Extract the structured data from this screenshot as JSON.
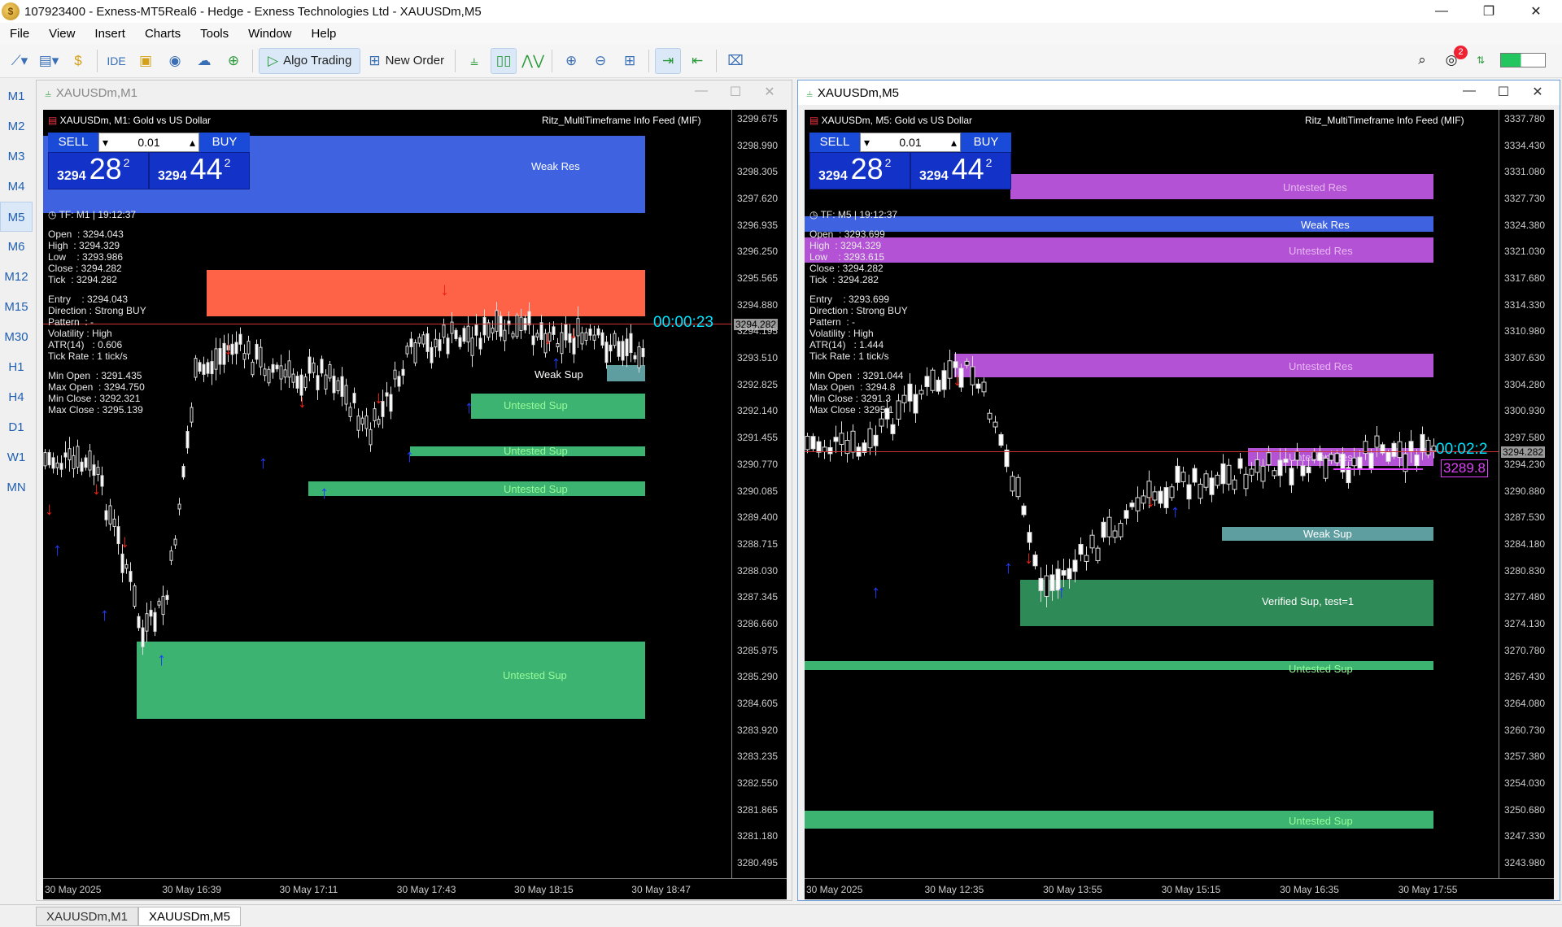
{
  "window": {
    "title": "107923400 - Exness-MT5Real6 - Hedge - Exness Technologies Ltd - XAUUSDm,M5",
    "minimize": "—",
    "maximize": "❐",
    "close": "✕"
  },
  "menu": [
    "File",
    "Insert",
    "Charts",
    "Tools",
    "Window",
    "Help",
    "View"
  ],
  "menu_order": [
    "File",
    "View",
    "Insert",
    "Charts",
    "Tools",
    "Window",
    "Help"
  ],
  "toolbar": {
    "ide": "IDE",
    "algo": "Algo Trading",
    "new_order": "New Order",
    "badge": "2"
  },
  "timeframes": [
    "M1",
    "M2",
    "M3",
    "M4",
    "M5",
    "M6",
    "M12",
    "M15",
    "M30",
    "H1",
    "H4",
    "D1",
    "W1",
    "MN"
  ],
  "active_timeframe": "M5",
  "charts": [
    {
      "title": "XAUUSDm,M1",
      "header": "XAUUSDm, M1:  Gold vs US Dollar",
      "indicator": "Ritz_MultiTimeframe Info Feed (MIF)",
      "trade": {
        "sell": "SELL",
        "buy": "BUY",
        "lot": "0.01",
        "bid_small": "3294",
        "bid_big": "28",
        "bid_sup": "2",
        "ask_small": "3294",
        "ask_big": "44",
        "ask_sup": "2"
      },
      "tf_line": "TF: M1 | 19:12:37",
      "ohlc": [
        "Open  : 3294.043",
        "High  : 3294.329",
        "Low    : 3293.986",
        "Close : 3294.282",
        "Tick  : 3294.282"
      ],
      "signal": [
        "Entry    : 3294.043",
        "Direction : Strong BUY",
        "Pattern  : -",
        "Volatility : High",
        "ATR(14)   : 0.606",
        "Tick Rate : 1 tick/s"
      ],
      "stats": [
        "Min Open  : 3291.435",
        "Max Open  : 3294.750",
        "Min Close : 3292.321",
        "Max Close : 3295.139"
      ],
      "timer": "00:00:23",
      "current_price": "3294.282",
      "yticks": [
        "3299.675",
        "3298.990",
        "3298.305",
        "3297.620",
        "3296.935",
        "3296.250",
        "3295.565",
        "3294.880",
        "3294.195",
        "3293.510",
        "3292.825",
        "3292.140",
        "3291.455",
        "3290.770",
        "3290.085",
        "3289.400",
        "3288.715",
        "3288.030",
        "3287.345",
        "3286.660",
        "3285.975",
        "3285.290",
        "3284.605",
        "3283.920",
        "3283.235",
        "3282.550",
        "3281.865",
        "3281.180",
        "3280.495"
      ],
      "xticks": [
        "30 May 2025",
        "30 May 16:39",
        "30 May 17:11",
        "30 May 17:43",
        "30 May 18:15",
        "30 May 18:47"
      ],
      "zones": [
        {
          "label": "Weak Res",
          "color": "#3f63e0",
          "text": "#ffffff"
        },
        {
          "label": "",
          "color": "#ff6347",
          "text": "#ffffff"
        },
        {
          "label": "Weak Sup",
          "color": "#5f9ea0",
          "text": "#ffffff"
        },
        {
          "label": "Untested Sup",
          "color": "#3cb371",
          "text": "#98fb98"
        },
        {
          "label": "Untested Sup",
          "color": "#3cb371",
          "text": "#98fb98"
        },
        {
          "label": "Untested Sup",
          "color": "#3cb371",
          "text": "#98fb98"
        },
        {
          "label": "Untested Sup",
          "color": "#3cb371",
          "text": "#98fb98"
        }
      ]
    },
    {
      "title": "XAUUSDm,M5",
      "header": "XAUUSDm, M5:  Gold vs US Dollar",
      "indicator": "Ritz_MultiTimeframe Info Feed (MIF)",
      "trade": {
        "sell": "SELL",
        "buy": "BUY",
        "lot": "0.01",
        "bid_small": "3294",
        "bid_big": "28",
        "bid_sup": "2",
        "ask_small": "3294",
        "ask_big": "44",
        "ask_sup": "2"
      },
      "tf_line": "TF: M5 | 19:12:37",
      "ohlc": [
        "Open  : 3293.699",
        "High  : 3294.329",
        "Low    : 3293.615",
        "Close : 3294.282",
        "Tick  : 3294.282"
      ],
      "signal": [
        "Entry    : 3293.699",
        "Direction : Strong BUY",
        "Pattern  : -",
        "Volatility : High",
        "ATR(14)   : 1.444",
        "Tick Rate : 1 tick/s"
      ],
      "stats": [
        "Min Open  : 3291.044",
        "Max Open  : 3294.8",
        "Min Close : 3291.3",
        "Max Close : 3295.1"
      ],
      "timer": "00:02:2",
      "current_price": "3294.282",
      "marker_price": "3289.8",
      "yticks": [
        "3337.780",
        "3334.430",
        "3331.080",
        "3327.730",
        "3324.380",
        "3321.030",
        "3317.680",
        "3314.330",
        "3310.980",
        "3307.630",
        "3304.280",
        "3300.930",
        "3297.580",
        "3294.230",
        "3290.880",
        "3287.530",
        "3284.180",
        "3280.830",
        "3277.480",
        "3274.130",
        "3270.780",
        "3267.430",
        "3264.080",
        "3260.730",
        "3257.380",
        "3254.030",
        "3250.680",
        "3247.330",
        "3243.980"
      ],
      "xticks": [
        "30 May 2025",
        "30 May 12:35",
        "30 May 13:55",
        "30 May 15:15",
        "30 May 16:35",
        "30 May 17:55"
      ],
      "zones": [
        {
          "label": "Untested Res",
          "color": "#b452d6",
          "text": "#e7b8f2"
        },
        {
          "label": "Weak Res",
          "color": "#3f63e0",
          "text": "#ffffff"
        },
        {
          "label": "Untested Res",
          "color": "#b452d6",
          "text": "#e7b8f2"
        },
        {
          "label": "Untested Res",
          "color": "#b452d6",
          "text": "#e7b8f2"
        },
        {
          "label": "Untested Res",
          "color": "#b452d6",
          "text": "#e7b8f2"
        },
        {
          "label": "Weak Sup",
          "color": "#5f9ea0",
          "text": "#ffffff"
        },
        {
          "label": "Verified Sup, test=1",
          "color": "#2e8b57",
          "text": "#ffffff"
        },
        {
          "label": "Untested Sup",
          "color": "#3cb371",
          "text": "#98fb98"
        },
        {
          "label": "Untested Sup",
          "color": "#3cb371",
          "text": "#98fb98"
        }
      ]
    }
  ],
  "bottom_tabs": [
    "XAUUSDm,M1",
    "XAUUSDm,M5"
  ]
}
